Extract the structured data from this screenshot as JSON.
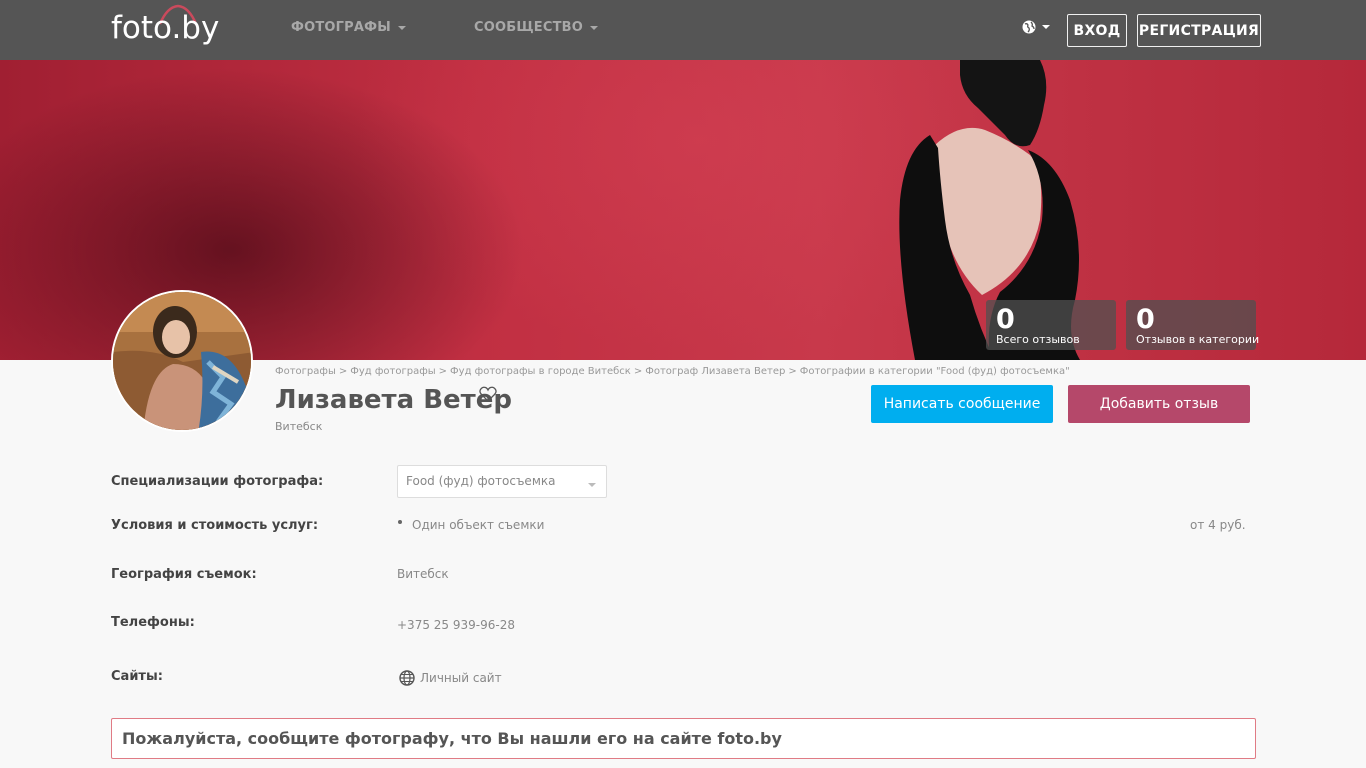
{
  "header": {
    "logo_text": "foto.by",
    "nav": [
      {
        "label": "ФОТОГРАФЫ"
      },
      {
        "label": "СООБЩЕСТВО"
      }
    ],
    "login_label": "ВХОД",
    "register_label": "РЕГИСТРАЦИЯ"
  },
  "stats": [
    {
      "value": "0",
      "label": "Всего отзывов"
    },
    {
      "value": "0",
      "label": "Отзывов в категории"
    }
  ],
  "breadcrumbs": [
    "Фотографы",
    "Фуд фотографы",
    "Фуд фотографы в городе Витебск",
    "Фотограф Лизавета Ветер",
    "Фотографии в категории \"Food (фуд) фотосъемка\""
  ],
  "profile": {
    "name": "Лизавета Ветер",
    "city": "Витебск",
    "message_button": "Написать сообщение",
    "review_button": "Добавить отзыв"
  },
  "colors": {
    "message_button": "#00aeef",
    "review_button": "#b5486a",
    "topbar": "#555555",
    "notice_border": "#e07b85"
  },
  "info": {
    "specializations_label": "Специализации фотографа:",
    "specialization_selected": "Food (фуд) фотосъемка",
    "pricing_label": "Условия и стоимость услуг:",
    "pricing_item": "Один объект съемки",
    "pricing_price": "от 4 руб.",
    "geography_label": "География съемок:",
    "geography_value": "Витебск",
    "phones_label": "Телефоны:",
    "phone_value": "+375 25 939-96-28",
    "sites_label": "Сайты:",
    "site_link": "Личный сайт"
  },
  "notice": "Пожалуйста, сообщите фотографу, что Вы нашли его на сайте foto.by"
}
